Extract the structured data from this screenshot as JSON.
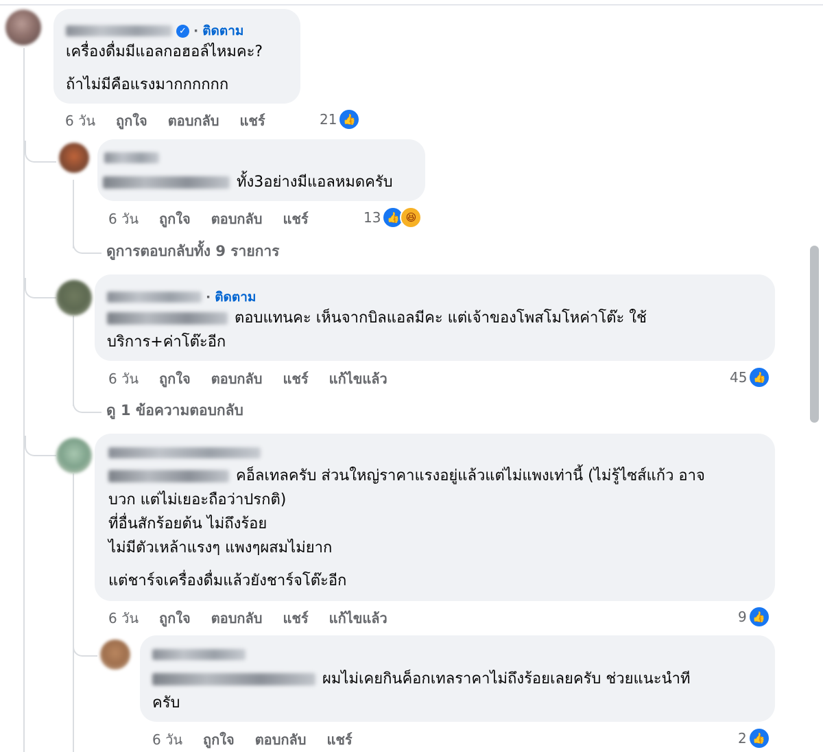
{
  "comments": [
    {
      "text_lines": [
        "เครื่องดื่มมีแอลกอฮอล์ไหมคะ?",
        "ถ้าไม่มีคือแรงมากกกกกก"
      ],
      "follow_label": "ติดตาม",
      "time": "6 วัน",
      "actions": [
        "ถูกใจ",
        "ตอบกลับ",
        "แชร์"
      ],
      "reaction_count": "21"
    },
    {
      "text": "ทั้ง3อย่างมีแอลหมดครับ",
      "time": "6 วัน",
      "actions": [
        "ถูกใจ",
        "ตอบกลับ",
        "แชร์"
      ],
      "reaction_count": "13"
    },
    {
      "follow_label": "ติดตาม",
      "text_lines": [
        "ตอบแทนคะ เห็นจากบิลแอลมีคะ แต่เจ้าของโพสโมโหค่าโต๊ะ ใช้",
        "บริการ+ค่าโต๊ะอีก"
      ],
      "time": "6 วัน",
      "actions": [
        "ถูกใจ",
        "ตอบกลับ",
        "แชร์",
        "แก้ไขแล้ว"
      ],
      "reaction_count": "45"
    },
    {
      "text_lines": [
        "คอ็ลเทลครับ ส่วนใหญ่ราคาแรงอยู่แล้วแต่ไม่แพงเท่านี้ (ไม่รู้ไซส์แก้ว อาจ",
        "บวก แต่ไม่เยอะถือว่าปรกติ)",
        "ที่อื่นสักร้อยต้น ไม่ถึงร้อย",
        "ไม่มีตัวเหล้าแรงๆ แพงๆผสมไม่ยาก",
        "แต่ชาร์จเครื่องดื่มแล้วยังชาร์จโต๊ะอีก"
      ],
      "time": "6 วัน",
      "actions": [
        "ถูกใจ",
        "ตอบกลับ",
        "แชร์",
        "แก้ไขแล้ว"
      ],
      "reaction_count": "9"
    },
    {
      "text_lines": [
        "ผมไม่เคยกินค็อกเทลราคาไม่ถึงร้อยเลยครับ ช่วยแนะนำที",
        "ครับ"
      ],
      "time": "6 วัน",
      "actions": [
        "ถูกใจ",
        "ตอบกลับ",
        "แชร์"
      ],
      "reaction_count": "2"
    }
  ],
  "view_replies": [
    "ดูการตอบกลับทั้ง 9 รายการ",
    "ดู 1 ข้อความตอบกลับ"
  ],
  "icons": {
    "like": "like-icon",
    "haha": "haha-icon",
    "verified": "verified-badge-icon"
  },
  "colors": {
    "bubble": "#f0f2f5",
    "link": "#0064d1",
    "muted": "#65676b",
    "like": "#1877f2"
  }
}
